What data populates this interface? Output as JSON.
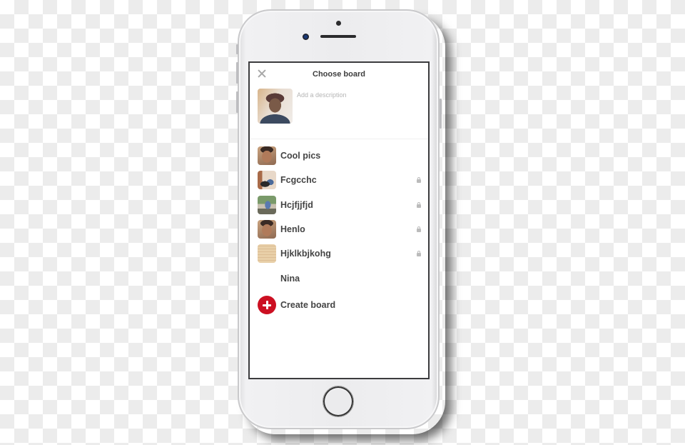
{
  "header": {
    "title": "Choose board",
    "close_icon": "close-x-icon"
  },
  "pin": {
    "description_placeholder": "Add a description",
    "description_value": ""
  },
  "boards": [
    {
      "name": "Cool pics",
      "secret": false,
      "thumb": "face"
    },
    {
      "name": "Fcgcchc",
      "secret": true,
      "thumb": "room"
    },
    {
      "name": "Hcjfjjfjd",
      "secret": true,
      "thumb": "outdoor"
    },
    {
      "name": "Henlo",
      "secret": true,
      "thumb": "face"
    },
    {
      "name": "Hjklkbjkohg",
      "secret": true,
      "thumb": "paper"
    },
    {
      "name": "Nina",
      "secret": false,
      "thumb": "none"
    }
  ],
  "create": {
    "label": "Create board",
    "icon": "plus-circle-icon"
  },
  "colors": {
    "accent": "#cc1022",
    "text": "#444444",
    "muted": "#b5b5b5"
  }
}
